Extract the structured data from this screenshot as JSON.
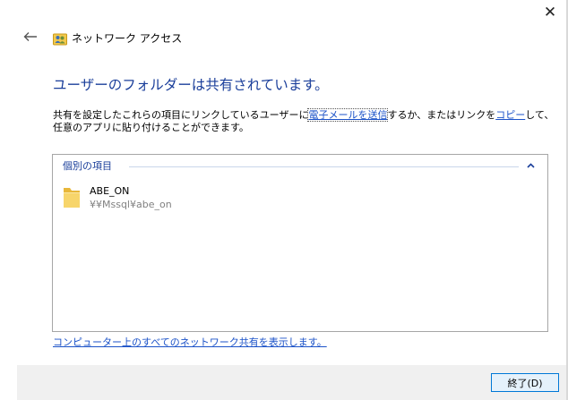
{
  "window": {
    "close_glyph": "✕",
    "title": "ネットワーク アクセス"
  },
  "heading": "ユーザーのフォルダーは共有されています。",
  "description": {
    "part1": "共有を設定したこれらの項目にリンクしているユーザーに",
    "email_link": "電子メールを送信",
    "part2": "するか、またはリンクを",
    "copy_link": "コピー",
    "part3": "して、任意のアプリに貼り付けることができます。"
  },
  "shared_items": {
    "group_title": "個別の項目",
    "items": [
      {
        "name": "ABE_ON",
        "path": "¥¥Mssql¥abe_on",
        "icon": "folder-icon"
      }
    ]
  },
  "view_all_link": "コンピューター上のすべてのネットワーク共有を表示します。",
  "footer": {
    "finish_label": "終了(D)"
  },
  "colors": {
    "heading": "#1a3e9a",
    "link": "#1b52c8",
    "button_border": "#0078d7",
    "footer_bg": "#f0f0f0"
  }
}
